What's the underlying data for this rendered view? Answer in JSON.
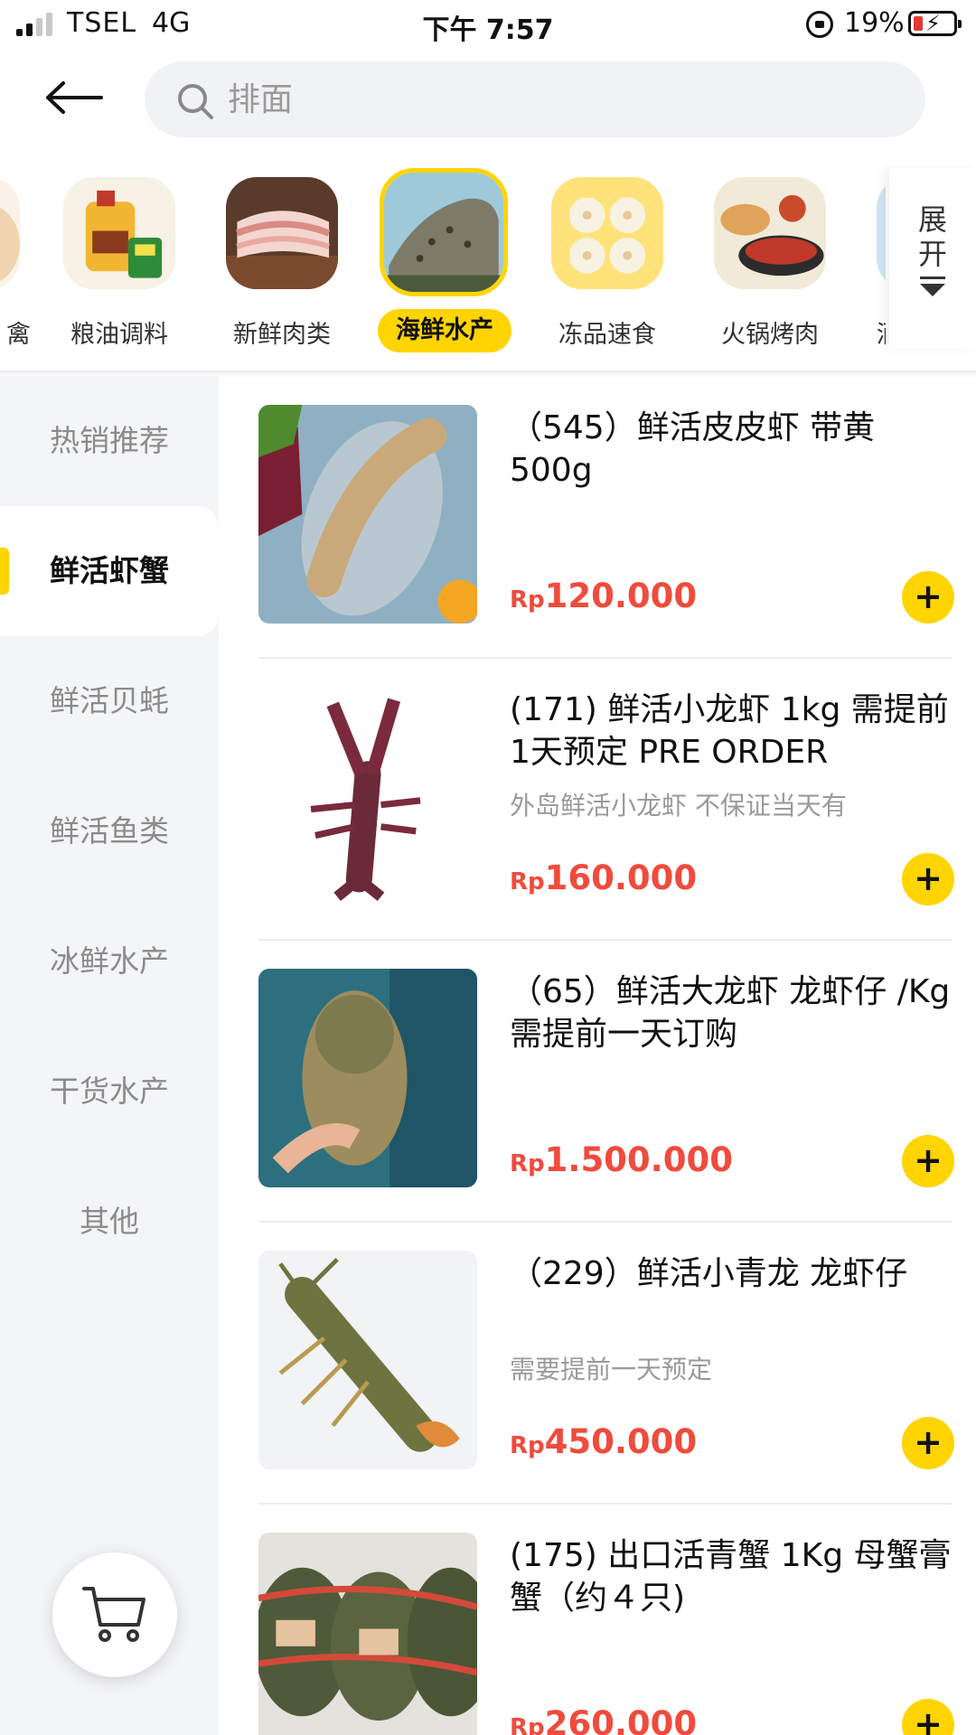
{
  "status_bar": {
    "carrier": "TSEL",
    "network": "4G",
    "time": "下午 7:57",
    "battery_percent": "19%",
    "bolt": "⚡"
  },
  "header": {
    "search_placeholder": "排面"
  },
  "categories": [
    {
      "label": "禽",
      "icon": "poultry-egg",
      "colors": [
        "#f7e6d2",
        "#e9c18f"
      ]
    },
    {
      "label": "粮油调料",
      "icon": "oil-seasoning",
      "colors": [
        "#f4c44a",
        "#2f8f3b"
      ]
    },
    {
      "label": "新鲜肉类",
      "icon": "fresh-pork",
      "colors": [
        "#c9a08a",
        "#f1d2cc"
      ]
    },
    {
      "label": "海鲜水产",
      "icon": "fish",
      "colors": [
        "#8fc3d6",
        "#6b6a58"
      ]
    },
    {
      "label": "冻品速食",
      "icon": "dumplings",
      "colors": [
        "#ffe58a",
        "#f6efe0"
      ]
    },
    {
      "label": "火锅烤肉",
      "icon": "hotpot",
      "colors": [
        "#e0b58a",
        "#b43a26"
      ]
    },
    {
      "label": "酒",
      "icon": "drinks",
      "colors": [
        "#8ec0e0",
        "#e9a43b"
      ]
    }
  ],
  "expand_label": "展开",
  "sidebar": {
    "items": [
      "热销推荐",
      "鲜活虾蟹",
      "鲜活贝蚝",
      "鲜活鱼类",
      "冰鲜水产",
      "干货水产",
      "其他"
    ],
    "active_index": 1
  },
  "products": [
    {
      "title": "（545）鲜活皮皮虾 带黄 500g",
      "desc": "",
      "currency": "Rp",
      "price": "120.000",
      "image": "mantis-shrimp"
    },
    {
      "title": "(171) 鲜活小龙虾 1kg 需提前1天预定 PRE ORDER",
      "desc": "外岛鲜活小龙虾 不保证当天有",
      "currency": "Rp",
      "price": "160.000",
      "image": "crayfish"
    },
    {
      "title": "（65）鲜活大龙虾 龙虾仔 /Kg  需提前一天订购",
      "desc": "",
      "currency": "Rp",
      "price": "1.500.000",
      "image": "lobster-in-hand"
    },
    {
      "title": "（229）鲜活小青龙 龙虾仔",
      "desc": "需要提前一天预定",
      "currency": "Rp",
      "price": "450.000",
      "image": "spiny-lobster"
    },
    {
      "title": "(175) 出口活青蟹 1Kg 母蟹膏蟹（约４只)",
      "desc": "",
      "currency": "Rp",
      "price": "260.000",
      "image": "mud-crabs"
    }
  ],
  "add_label": "+",
  "colors": {
    "accent": "#ffd400",
    "price": "#f04b3c"
  }
}
